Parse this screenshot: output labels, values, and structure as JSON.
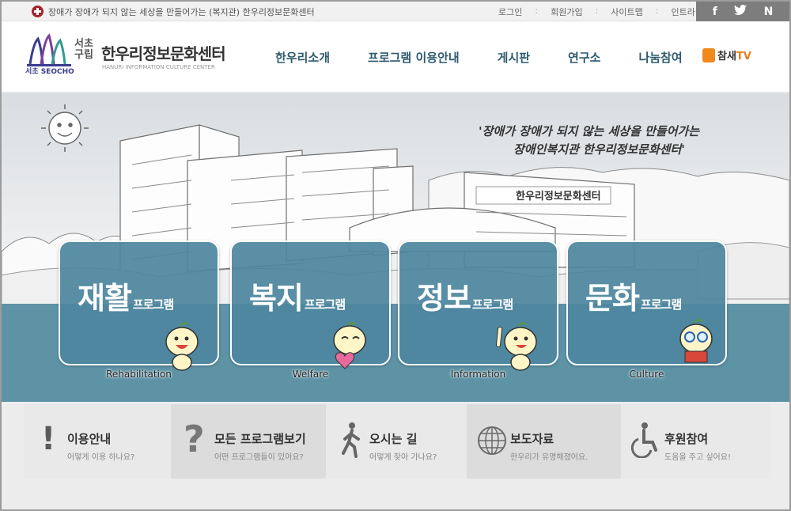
{
  "topbar": {
    "tagline": "장애가 장애가 되지 않는 세상을 만들어가는 (복지관) 한우리정보문화센터",
    "links": [
      "로그인",
      "회원가입",
      "사이트맵",
      "인트라넷"
    ],
    "sns": [
      "f",
      "t",
      "N"
    ]
  },
  "header": {
    "logo_seocho": "서초 SEOCHO",
    "logo_gu": "서초구립",
    "logo_title": "한우리정보문화센터",
    "logo_sub": "HANURI INFORMATION CULTURE CENTER",
    "nav": [
      "한우리소개",
      "프로그램 이용안내",
      "게시판",
      "연구소",
      "나눔참여"
    ],
    "tv_label_main": "참새",
    "tv_label_suffix": "TV"
  },
  "hero": {
    "quote_line1": "'장애가 장애가 되지 않는 세상을 만들어가는",
    "quote_line2": "장애인복지관 한우리정보문화센터'",
    "building_sign": "한우리정보문화센터",
    "cards": [
      {
        "kor": "재활",
        "suffix": "프로그램",
        "eng": "Rehabilitation"
      },
      {
        "kor": "복지",
        "suffix": "프로그램",
        "eng": "Welfare"
      },
      {
        "kor": "정보",
        "suffix": "프로그램",
        "eng": "Information"
      },
      {
        "kor": "문화",
        "suffix": "프로그램",
        "eng": "Culture"
      }
    ]
  },
  "quick": [
    {
      "icon": "!",
      "title": "이용안내",
      "desc": "어떻게 이용 하나요?"
    },
    {
      "icon": "?",
      "title": "모든 프로그램보기",
      "desc": "어떤 프로그램들이 있어요?"
    },
    {
      "icon": "walker",
      "title": "오시는 길",
      "desc": "어떻게 찾아 가나요?"
    },
    {
      "icon": "globe",
      "title": "보도자료",
      "desc": "한우리가 유명해졌어요."
    },
    {
      "icon": "wheelchair",
      "title": "후원참여",
      "desc": "도움을 주고 싶어요!"
    }
  ],
  "colors": {
    "nav_text": "#2e5a70",
    "card_teal": "#4d879e",
    "band_teal": "#5e93a6",
    "tv_orange": "#f08a1c"
  }
}
